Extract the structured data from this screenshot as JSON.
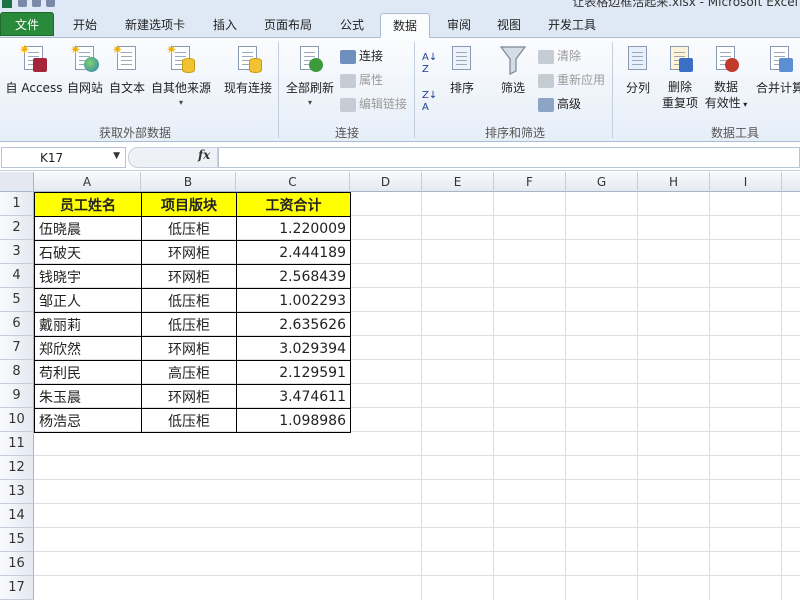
{
  "window": {
    "title": "让表格边框活起来.xlsx - Microsoft Excel"
  },
  "tabs": [
    {
      "label": "文件"
    },
    {
      "label": "开始"
    },
    {
      "label": "新建选项卡"
    },
    {
      "label": "插入"
    },
    {
      "label": "页面布局"
    },
    {
      "label": "公式"
    },
    {
      "label": "数据"
    },
    {
      "label": "审阅"
    },
    {
      "label": "视图"
    },
    {
      "label": "开发工具"
    }
  ],
  "ribbon": {
    "external": {
      "access": "自 Access",
      "web": "自网站",
      "text": "自文本",
      "other": "自其他来源",
      "existing": "现有连接",
      "group_label": "获取外部数据"
    },
    "connections": {
      "refresh_all": "全部刷新",
      "connections": "连接",
      "properties": "属性",
      "edit_links": "编辑链接",
      "group_label": "连接"
    },
    "sort_filter": {
      "sort": "排序",
      "filter": "筛选",
      "clear": "清除",
      "reapply": "重新应用",
      "advanced": "高级",
      "group_label": "排序和筛选"
    },
    "data_tools": {
      "split": "分列",
      "remove_dup_line1": "删除",
      "remove_dup_line2": "重复项",
      "validation_line1": "数据",
      "validation_line2": "有效性",
      "consolidate": "合并计算",
      "group_label": "数据工具"
    }
  },
  "formula_bar": {
    "name_box": "K17",
    "fx_label": "fx",
    "formula": ""
  },
  "grid": {
    "columns": [
      "A",
      "B",
      "C",
      "D",
      "E",
      "F",
      "G",
      "H",
      "I"
    ],
    "rows": [
      "1",
      "2",
      "3",
      "4",
      "5",
      "6",
      "7",
      "8",
      "9",
      "10",
      "11",
      "12",
      "13",
      "14",
      "15",
      "16",
      "17"
    ],
    "headers": [
      "员工姓名",
      "项目版块",
      "工资合计"
    ],
    "records": [
      [
        "伍晓晨",
        "低压柜",
        "1.220009"
      ],
      [
        "石破天",
        "环网柜",
        "2.444189"
      ],
      [
        "钱晓宇",
        "环网柜",
        "2.568439"
      ],
      [
        "邹正人",
        "低压柜",
        "1.002293"
      ],
      [
        "戴丽莉",
        "低压柜",
        "2.635626"
      ],
      [
        "郑欣然",
        "环网柜",
        "3.029394"
      ],
      [
        "苟利民",
        "高压柜",
        "2.129591"
      ],
      [
        "朱玉晨",
        "环网柜",
        "3.474611"
      ],
      [
        "杨浩忌",
        "低压柜",
        "1.098986"
      ]
    ]
  },
  "colors": {
    "header_fill": "#ffff00",
    "file_tab": "#2a8a3c",
    "cell_border": "#000000"
  }
}
